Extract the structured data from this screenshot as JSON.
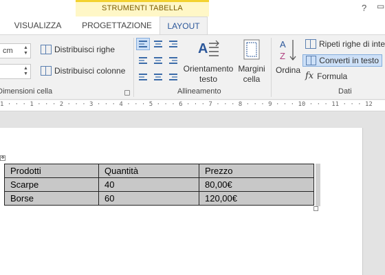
{
  "ribbon_tabs": {
    "context_title": "STRUMENTI TABELLA",
    "visualizza": "VISUALIZZA",
    "progettazione": "PROGETTAZIONE",
    "layout": "LAYOUT",
    "help": "?"
  },
  "cell_size_group": {
    "width_value": "cm",
    "height_value": "",
    "distribute_rows": "Distribuisci righe",
    "distribute_columns": "Distribuisci colonne",
    "label": "Dimensioni cella"
  },
  "alignment_group": {
    "text_direction_line1": "Orientamento",
    "text_direction_line2": "testo",
    "cell_margins_line1": "Margini",
    "cell_margins_line2": "cella",
    "label": "Allineamento"
  },
  "data_group": {
    "sort": "Ordina",
    "repeat_header_rows": "Ripeti righe di intes",
    "convert_to_text": "Converti in testo",
    "formula": "Formula",
    "label": "Dati"
  },
  "ruler": {
    "text": "1 · · · 1 · · · 2 · · · 3 · · · 4 · · · 5 · · · 6 · · · 7 · · · 8 · · · 9 · · · 10 · · · 11 · · · 12"
  },
  "table": {
    "rows": [
      [
        "Prodotti",
        "Quantità",
        "Prezzo"
      ],
      [
        "Scarpe",
        "40",
        "80,00€"
      ],
      [
        "Borse",
        "60",
        "120,00€"
      ]
    ]
  },
  "colors": {
    "accent": "#2b579a",
    "context_band": "#fff7c7",
    "context_border": "#f3d230",
    "table_fill": "#c8c8c8"
  }
}
